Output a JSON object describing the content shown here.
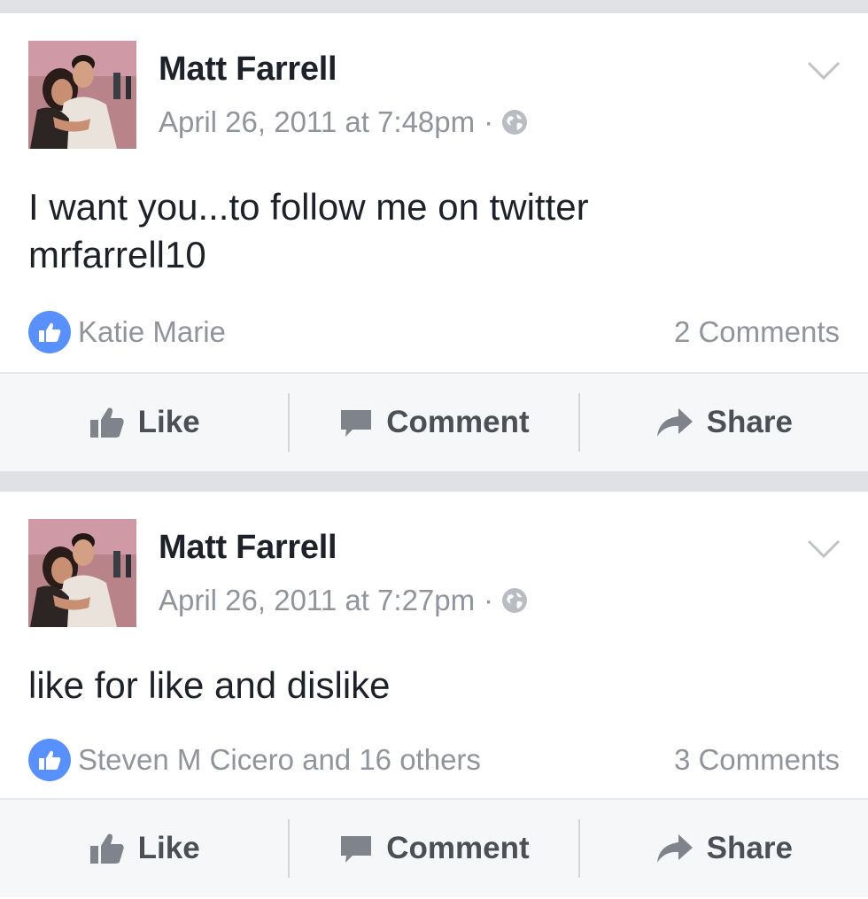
{
  "posts": [
    {
      "author": "Matt Farrell",
      "timestamp": "April 26, 2011 at 7:48pm",
      "separator": "·",
      "privacy_icon": "globe-icon",
      "text_line1": "I want you...to follow me on twitter",
      "text_line2": "mrfarrell10",
      "likes": "Katie Marie",
      "comments": "2 Comments",
      "actions": {
        "like": "Like",
        "comment": "Comment",
        "share": "Share"
      }
    },
    {
      "author": "Matt Farrell",
      "timestamp": "April 26, 2011 at 7:27pm",
      "separator": "·",
      "privacy_icon": "globe-icon",
      "text_line1": "like for like and dislike",
      "likes": "Steven M Cicero and 16 others",
      "comments": "3 Comments",
      "actions": {
        "like": "Like",
        "comment": "Comment",
        "share": "Share"
      }
    }
  ],
  "colors": {
    "like_badge": "#5890ff",
    "secondary_text": "#90949c",
    "action_text": "#4b4f56",
    "feed_background": "#dfe1e4"
  }
}
